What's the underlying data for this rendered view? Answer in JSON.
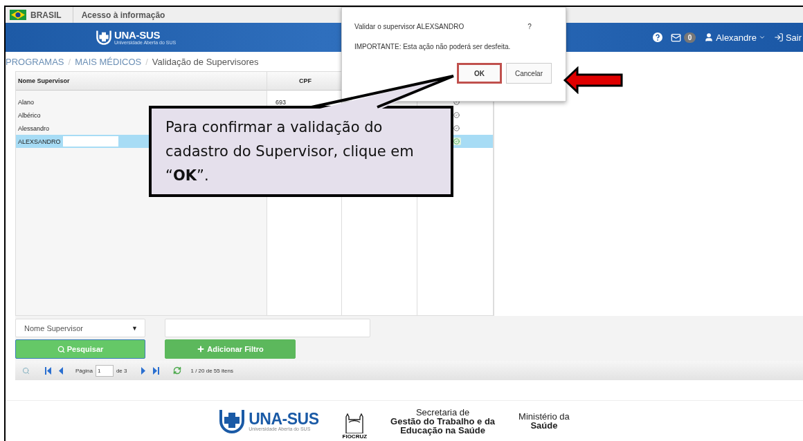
{
  "gov_bar": {
    "country": "BRASIL",
    "link": "Acesso à informação"
  },
  "header": {
    "logo": "UNA-SUS",
    "logo_subtitle": "Universidade Aberta do SUS",
    "message_count": "0",
    "user": "Alexandre",
    "logout": "Sair"
  },
  "breadcrumb": {
    "separator": "/",
    "items": [
      "PROGRAMAS",
      "MAIS MÉDICOS",
      "Validação de Supervisores"
    ]
  },
  "table": {
    "columns": [
      "Nome Supervisor",
      "CPF"
    ],
    "rows": [
      {
        "name": "Alano",
        "cpf": "693",
        "selected": false
      },
      {
        "name": "Albérico",
        "cpf": "",
        "selected": false
      },
      {
        "name": "Alessandro",
        "cpf": "",
        "selected": false
      },
      {
        "name": "ALEXSANDRO",
        "cpf": "",
        "selected": true
      }
    ]
  },
  "filter": {
    "field": "Nome Supervisor",
    "arrow": "▼",
    "search_button": "Pesquisar",
    "add_button": "Adicionar Filtro"
  },
  "pager": {
    "page_label": "Página",
    "page": "1",
    "page_count": "de 3",
    "summary": "1 / 20 de 55 itens"
  },
  "footer": {
    "unasus": "UNA-SUS",
    "unasus_subtitle": "Universidade Aberta do SUS",
    "fiocruz": "FIOCRUZ",
    "secretaria": [
      "Secretaria de",
      "Gestão do Trabalho e da",
      "Educação na Saúde"
    ],
    "ministerio": [
      "Ministério da",
      "Saúde"
    ]
  },
  "dialog": {
    "question": "Validar o supervisor ALEXSANDRO",
    "question_mark": "?",
    "warning": "IMPORTANTE: Esta ação não poderá ser desfeita.",
    "buttons": [
      {
        "label": "OK",
        "highlighted": true
      },
      {
        "label": "Cancelar",
        "highlighted": false
      }
    ]
  },
  "callout": {
    "text": "Para confirmar a validação do cadastro do Supervisor, clique em “**OK**”."
  }
}
